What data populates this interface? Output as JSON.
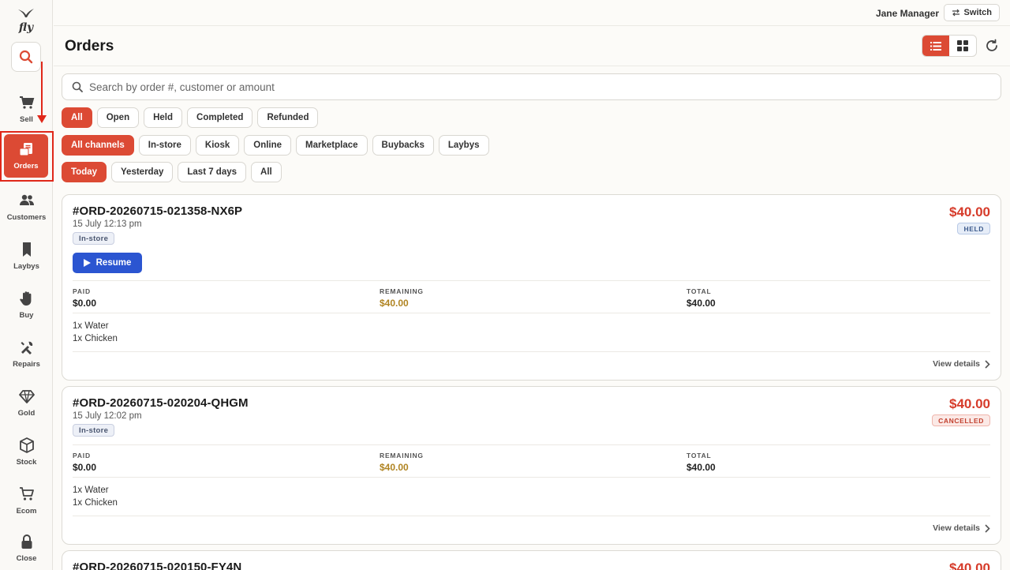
{
  "app": {
    "logo_text": "fly",
    "user_name": "Jane Manager",
    "switch_label": "Switch"
  },
  "sidebar": {
    "items": [
      {
        "label": "Sell",
        "icon": "cart-icon"
      },
      {
        "label": "Orders",
        "icon": "receipt-icon",
        "active": true
      },
      {
        "label": "Customers",
        "icon": "users-icon"
      },
      {
        "label": "Laybys",
        "icon": "bookmark-icon"
      },
      {
        "label": "Buy",
        "icon": "hand-icon"
      },
      {
        "label": "Repairs",
        "icon": "tools-icon"
      },
      {
        "label": "Gold",
        "icon": "diamond-icon"
      },
      {
        "label": "Stock",
        "icon": "box-icon"
      },
      {
        "label": "Ecom",
        "icon": "shopping-cart-icon"
      },
      {
        "label": "Close",
        "icon": "lock-icon"
      }
    ]
  },
  "page": {
    "title": "Orders",
    "view_mode": "list"
  },
  "search": {
    "placeholder": "Search by order #, customer or amount",
    "value": ""
  },
  "filters": {
    "status": [
      "All",
      "Open",
      "Held",
      "Completed",
      "Refunded"
    ],
    "status_selected": "All",
    "channels": [
      "All channels",
      "In-store",
      "Kiosk",
      "Online",
      "Marketplace",
      "Buybacks",
      "Laybys"
    ],
    "channel_selected": "All channels",
    "dates": [
      "Today",
      "Yesterday",
      "Last 7 days",
      "All"
    ],
    "date_selected": "Today"
  },
  "labels": {
    "paid": "PAID",
    "remaining": "REMAINING",
    "total": "TOTAL",
    "view_details": "View details",
    "resume": "Resume"
  },
  "orders": [
    {
      "id": "#ORD-20260715-021358-NX6P",
      "date": "15 July 12:13 pm",
      "channel": "In-store",
      "amount": "$40.00",
      "status": "HELD",
      "paid": "$0.00",
      "remaining": "$40.00",
      "total": "$40.00",
      "items": [
        "1x Water",
        "1x Chicken"
      ]
    },
    {
      "id": "#ORD-20260715-020204-QHGM",
      "date": "15 July 12:02 pm",
      "channel": "In-store",
      "amount": "$40.00",
      "status": "CANCELLED",
      "paid": "$0.00",
      "remaining": "$40.00",
      "total": "$40.00",
      "items": [
        "1x Water",
        "1x Chicken"
      ]
    },
    {
      "id": "#ORD-20260715-020150-FY4N",
      "amount": "$40.00"
    }
  ],
  "colors": {
    "accent": "#dc4a34",
    "resume": "#2b55d1",
    "remaining": "#b08422",
    "annotation": "#e0281a"
  }
}
